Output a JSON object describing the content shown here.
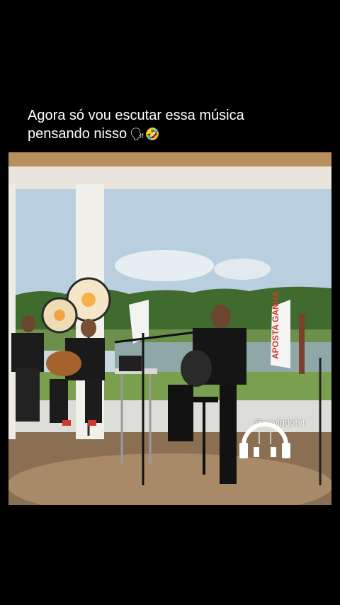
{
  "caption": {
    "line1": "Agora só vou escutar essa música",
    "line2": "pensando nisso",
    "emojis": "🗣🤣"
  },
  "video": {
    "banner_text": "APOSTA GANHA",
    "watermark_handle": "@ouvindohit",
    "watermark_icon": "headphones-icon"
  }
}
